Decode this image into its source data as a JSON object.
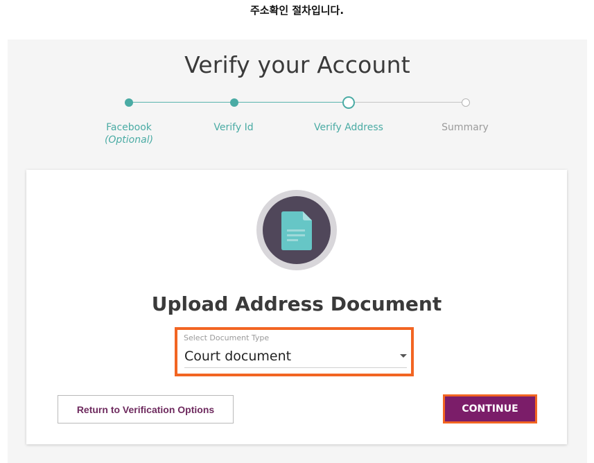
{
  "caption": "주소확인 절차입니다.",
  "page": {
    "title": "Verify your Account"
  },
  "stepper": {
    "steps": [
      {
        "label": "Facebook",
        "sublabel": "(Optional)",
        "state": "done"
      },
      {
        "label": "Verify Id",
        "state": "done"
      },
      {
        "label": "Verify Address",
        "state": "current"
      },
      {
        "label": "Summary",
        "state": "todo"
      }
    ]
  },
  "card": {
    "icon": "document-icon",
    "heading": "Upload Address Document",
    "select": {
      "label": "Select Document Type",
      "value": "Court document"
    },
    "return_button": "Return to Verification Options",
    "continue_button": "CONTINUE"
  },
  "colors": {
    "accent_teal": "#4aaba4",
    "primary_purple": "#7b1d69",
    "highlight_orange": "#f26522",
    "icon_circle": "#50475a"
  }
}
